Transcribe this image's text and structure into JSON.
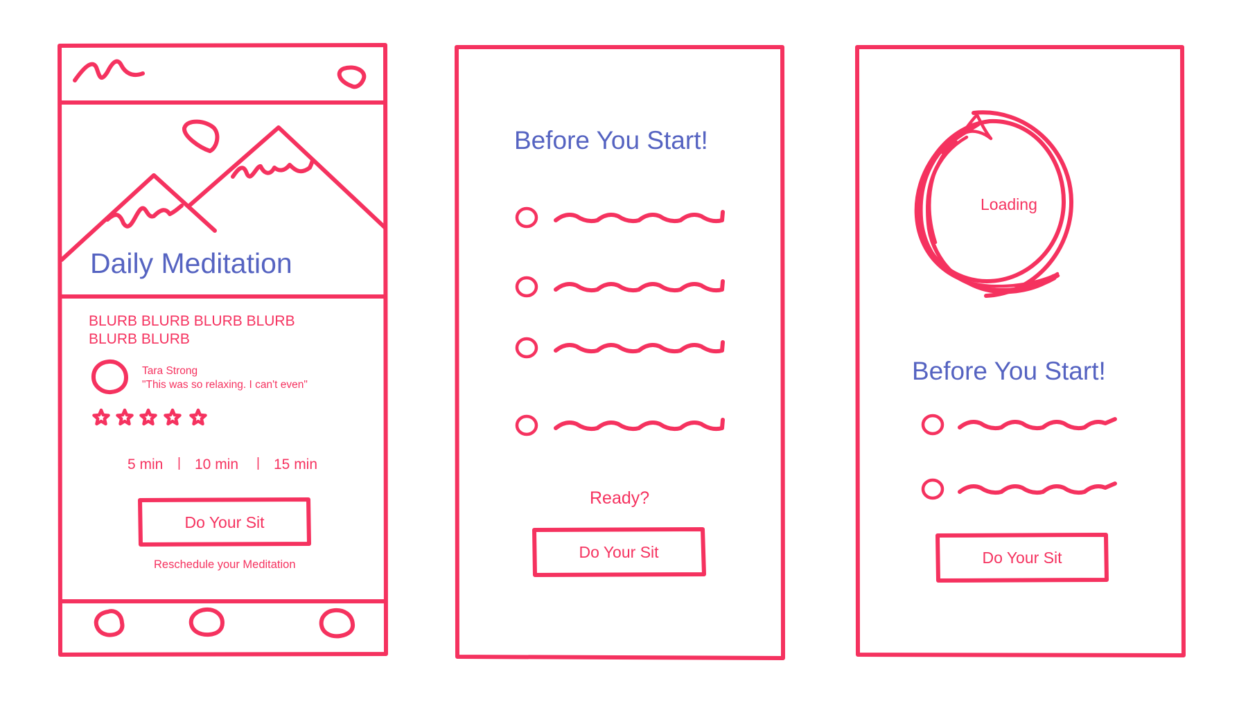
{
  "palette": {
    "ink": "#f5325f",
    "title": "#5563c1",
    "background": "#ffffff"
  },
  "screen1": {
    "header": {
      "logo_icon": "scribble-logo-icon",
      "profile_icon": "profile-circle-icon"
    },
    "hero": {
      "image_icon": "mountain-landscape-icon",
      "title": "Daily Meditation"
    },
    "blurb": {
      "line1": "BLURB BLURB BLURB BLURB",
      "line2": "BLURB BLURB"
    },
    "review": {
      "avatar_icon": "avatar-circle-icon",
      "name": "Tara Strong",
      "quote": "\"This was so relaxing. I can't even\"",
      "rating": 5,
      "rating_max": 5,
      "star_icon": "star-icon"
    },
    "durations": {
      "opt1": "5 min",
      "opt2": "10 min",
      "opt3": "15 min",
      "separator": "|"
    },
    "cta": "Do Your Sit",
    "reschedule_link": "Reschedule your Meditation",
    "bottom_nav": {
      "icons": [
        "nav-circle-icon",
        "nav-circle-icon",
        "nav-circle-icon"
      ]
    }
  },
  "screen2": {
    "title": "Before You Start!",
    "checklist": {
      "count": 4,
      "bullet_icon": "radio-circle-icon",
      "text_icon": "squiggle-text-icon"
    },
    "ready_label": "Ready?",
    "cta": "Do Your Sit"
  },
  "screen3": {
    "loader": {
      "label": "Loading",
      "icon": "loading-ring-icon"
    },
    "title": "Before You Start!",
    "checklist": {
      "count": 2,
      "bullet_icon": "radio-circle-icon",
      "text_icon": "squiggle-text-icon"
    },
    "cta": "Do Your Sit"
  }
}
